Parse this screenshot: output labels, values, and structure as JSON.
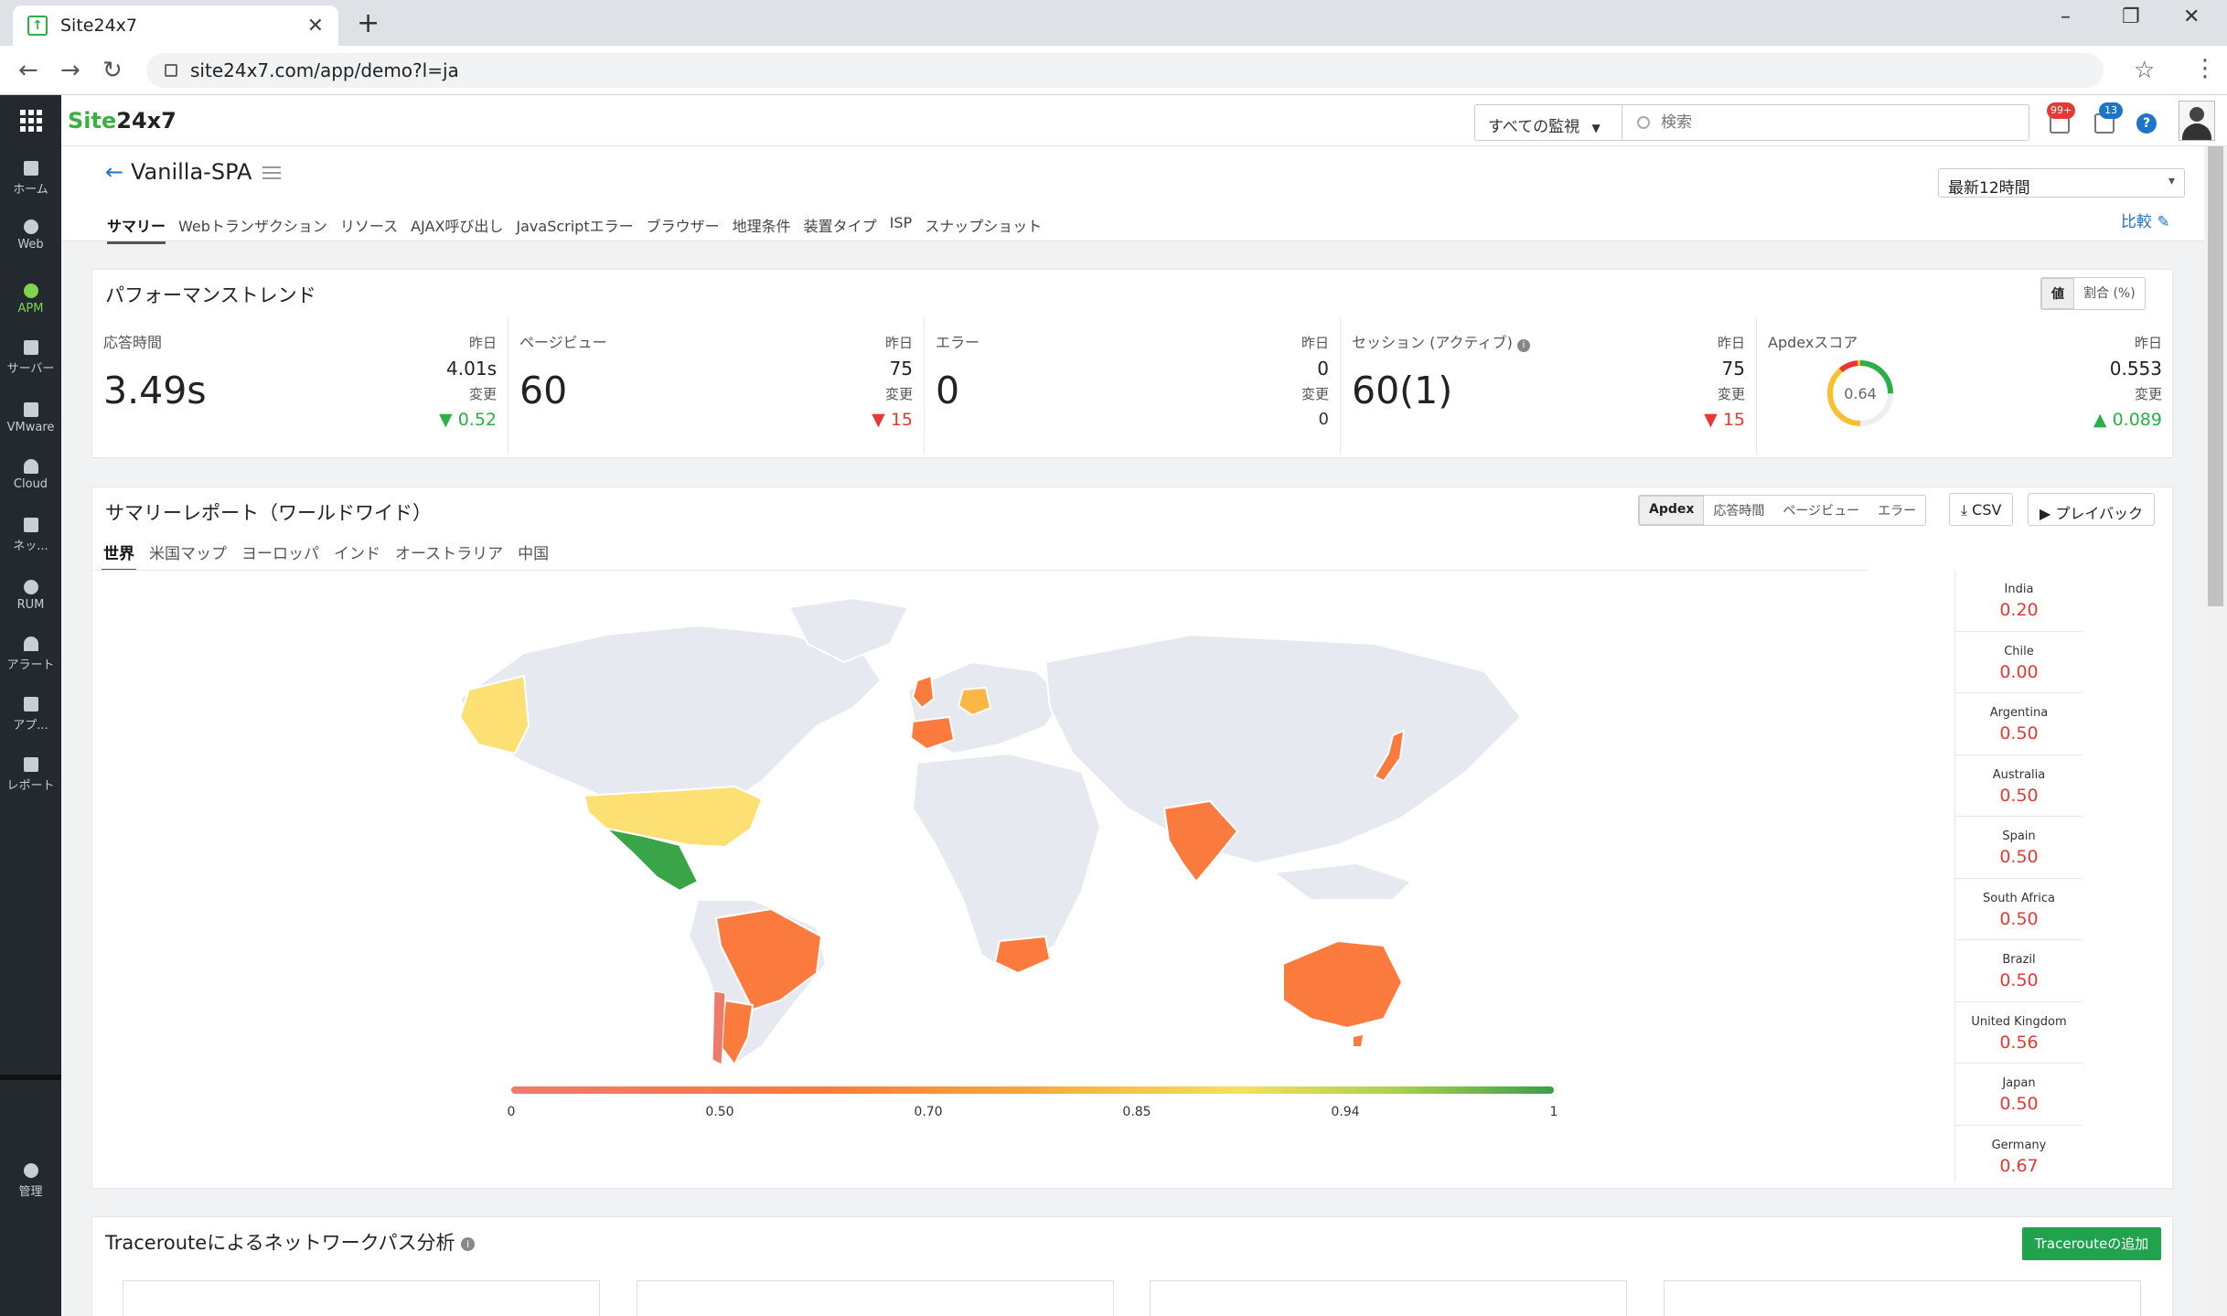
{
  "browser": {
    "tab_title": "Site24x7",
    "url": "site24x7.com/app/demo?l=ja"
  },
  "header": {
    "logo_site": "Site",
    "logo_rest": "24x7",
    "monitor_filter": "すべての監視",
    "search_placeholder": "検索",
    "alarm_badge": "99+",
    "notif_badge": "13",
    "help": "?"
  },
  "sidebar": {
    "items": [
      {
        "label": "ホーム"
      },
      {
        "label": "Web"
      },
      {
        "label": "APM"
      },
      {
        "label": "サーバー"
      },
      {
        "label": "VMware"
      },
      {
        "label": "Cloud"
      },
      {
        "label": "ネッ..."
      },
      {
        "label": "RUM"
      },
      {
        "label": "アラート"
      },
      {
        "label": "アプ..."
      },
      {
        "label": "レポート"
      }
    ],
    "admin_label": "管理"
  },
  "page": {
    "title": "Vanilla-SPA",
    "period": "最新12時間",
    "compare_label": "比較",
    "tabs": [
      "サマリー",
      "Webトランザクション",
      "リソース",
      "AJAX呼び出し",
      "JavaScriptエラー",
      "ブラウザー",
      "地理条件",
      "装置タイプ",
      "ISP",
      "スナップショット"
    ]
  },
  "performance": {
    "title": "パフォーマンストレンド",
    "toggle_value": "値",
    "toggle_ratio": "割合 (%)",
    "metrics": [
      {
        "label": "応答時間",
        "value": "3.49s",
        "yesterday_label": "昨日",
        "yesterday": "4.01s",
        "change_label": "変更",
        "change": "0.52",
        "trend": "down-good"
      },
      {
        "label": "ページビュー",
        "value": "60",
        "yesterday_label": "昨日",
        "yesterday": "75",
        "change_label": "変更",
        "change": "15",
        "trend": "down-bad"
      },
      {
        "label": "エラー",
        "value": "0",
        "yesterday_label": "昨日",
        "yesterday": "0",
        "change_label": "変更",
        "change": "0",
        "trend": "none"
      },
      {
        "label": "セッション (アクティブ)",
        "value": "60(1)",
        "yesterday_label": "昨日",
        "yesterday": "75",
        "change_label": "変更",
        "change": "15",
        "trend": "down-bad"
      },
      {
        "label": "Apdexスコア",
        "value": "0.64",
        "yesterday_label": "昨日",
        "yesterday": "0.553",
        "change_label": "変更",
        "change": "0.089",
        "trend": "up-good"
      }
    ]
  },
  "summary": {
    "title": "サマリーレポート（ワールドワイド）",
    "metric_tabs": [
      "Apdex",
      "応答時間",
      "ページビュー",
      "エラー"
    ],
    "csv_label": "CSV",
    "playback_label": "プレイバック",
    "region_tabs": [
      "世界",
      "米国マップ",
      "ヨーロッパ",
      "インド",
      "オーストラリア",
      "中国"
    ],
    "legend_ticks": [
      "0",
      "0.50",
      "0.70",
      "0.85",
      "0.94",
      "1"
    ],
    "countries": [
      {
        "name": "India",
        "value": "0.20"
      },
      {
        "name": "Chile",
        "value": "0.00"
      },
      {
        "name": "Argentina",
        "value": "0.50"
      },
      {
        "name": "Australia",
        "value": "0.50"
      },
      {
        "name": "Spain",
        "value": "0.50"
      },
      {
        "name": "South Africa",
        "value": "0.50"
      },
      {
        "name": "Brazil",
        "value": "0.50"
      },
      {
        "name": "United Kingdom",
        "value": "0.56"
      },
      {
        "name": "Japan",
        "value": "0.50"
      },
      {
        "name": "Germany",
        "value": "0.67"
      }
    ]
  },
  "traceroute": {
    "title": "Tracerouteによるネットワークパス分析",
    "add_button": "Tracerouteの追加"
  },
  "colors": {
    "accent_green": "#20a34c",
    "bad_red": "#e53935",
    "link_blue": "#1e74c6",
    "map_poor": "#fb7a3d",
    "map_ok": "#fbb648",
    "map_fair": "#fde073",
    "map_good": "#3aa548",
    "map_chile": "#f07a6a",
    "land": "#e6eaf0"
  }
}
